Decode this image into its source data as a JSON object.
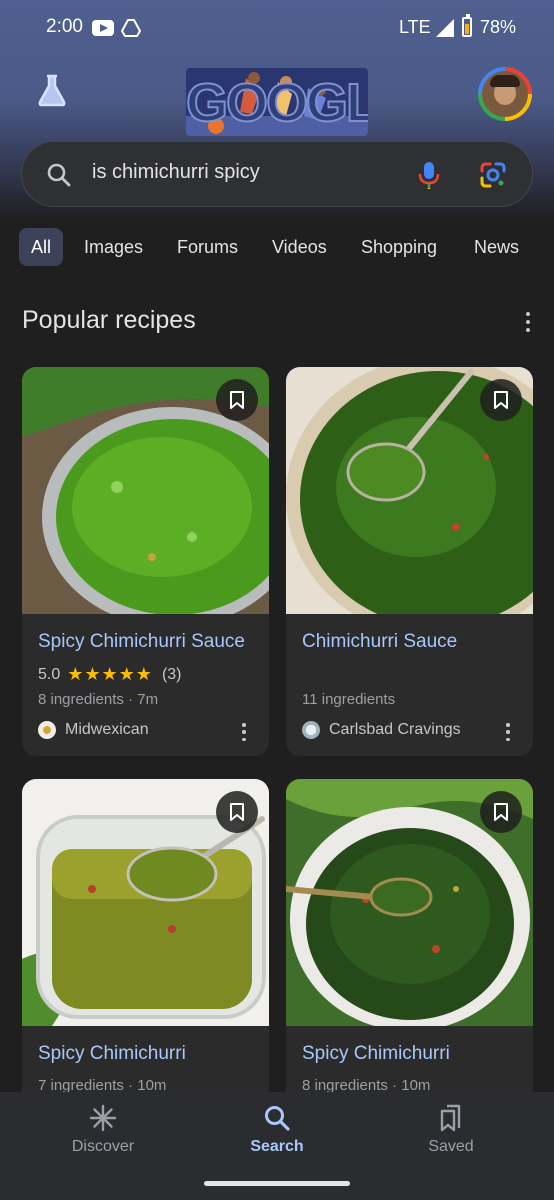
{
  "status_bar": {
    "time": "2:00",
    "network": "LTE",
    "battery": "78%"
  },
  "header": {
    "doodle_text": "GOOGLE"
  },
  "search": {
    "query": "is chimichurri spicy"
  },
  "filter_chips": [
    "All",
    "Images",
    "Forums",
    "Videos",
    "Shopping",
    "News"
  ],
  "section": {
    "title": "Popular recipes"
  },
  "recipes": [
    {
      "title": "Spicy Chimichurri Sauce",
      "rating": "5.0",
      "stars": "★★★★★",
      "reviews": "(3)",
      "meta": "8 ingredients · 7m",
      "source": "Midwexican"
    },
    {
      "title": "Chimichurri Sauce",
      "meta": "11 ingredients",
      "source": "Carlsbad Cravings"
    },
    {
      "title": "Spicy Chimichurri",
      "meta": "7 ingredients · 10m"
    },
    {
      "title": "Spicy Chimichurri",
      "meta": "8 ingredients · 10m"
    }
  ],
  "bottom_nav": {
    "discover": "Discover",
    "search": "Search",
    "saved": "Saved"
  },
  "colors": {
    "accent": "#a8c7fa",
    "star": "#fbbc04",
    "background": "#1f1f1f"
  }
}
